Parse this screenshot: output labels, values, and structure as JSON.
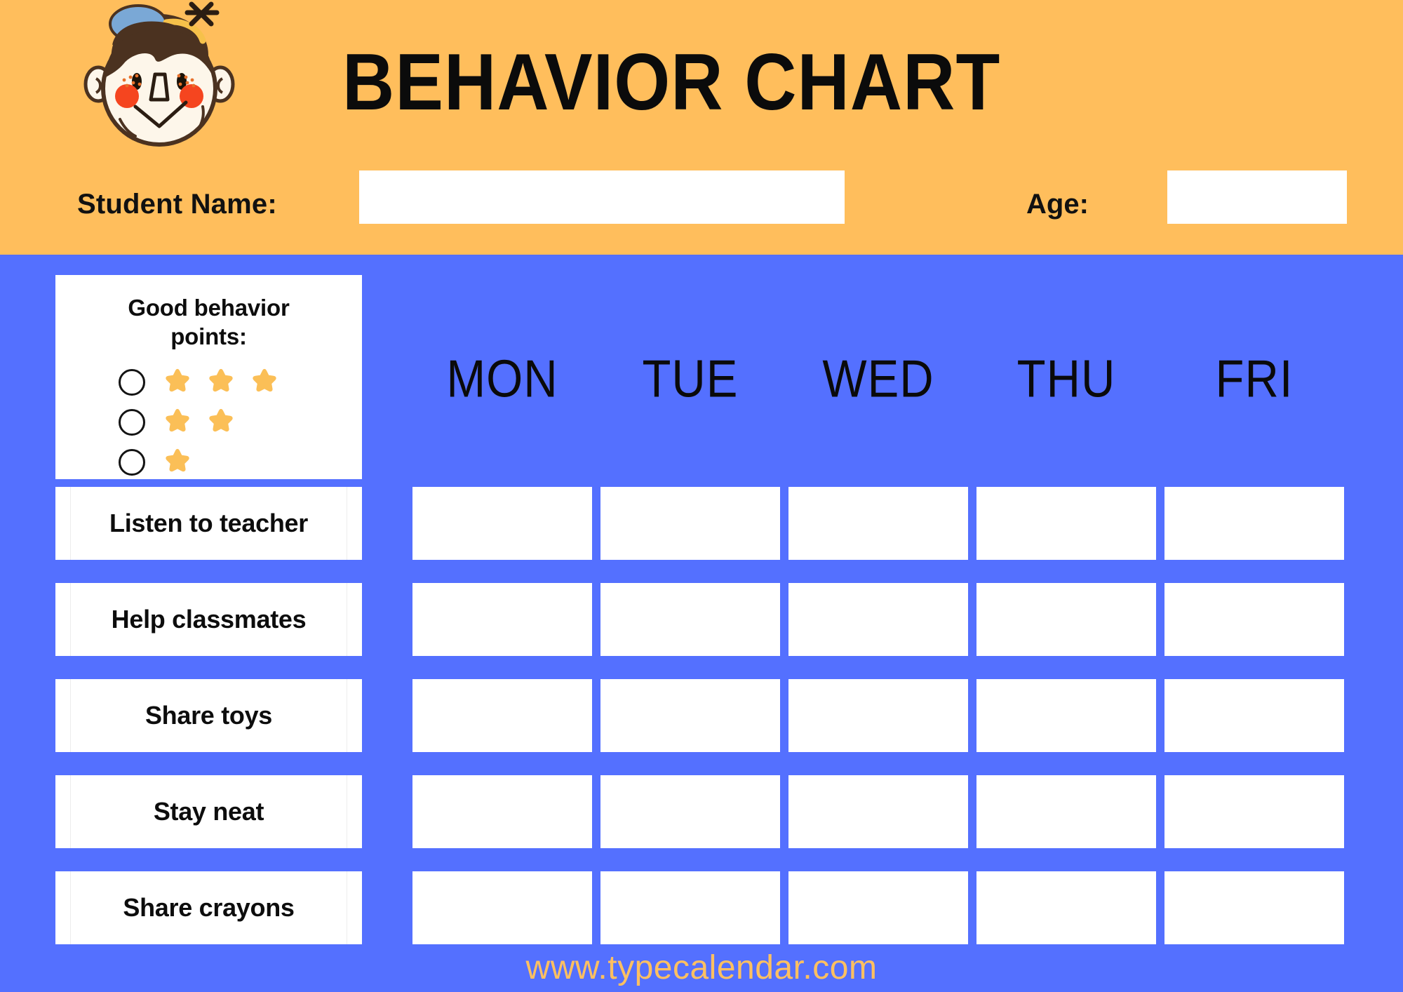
{
  "theme": {
    "header_bg": "#ffbe5c",
    "body_bg": "#5470ff",
    "cell_bg": "#ffffff",
    "star_color": "#fbbf57",
    "text_color": "#0d0d0d",
    "footer_color": "#ffc061"
  },
  "header": {
    "title": "BEHAVIOR CHART",
    "student_name_label": "Student Name:",
    "student_name_value": "",
    "student_name_placeholder": "",
    "age_label": "Age:",
    "age_value": "",
    "age_placeholder": "",
    "mascot_icon": "child-face-icon"
  },
  "legend": {
    "title_line1": "Good behavior",
    "title_line2": "points:",
    "rows": [
      {
        "checkbox": "circle-checkbox",
        "stars": 3
      },
      {
        "checkbox": "circle-checkbox",
        "stars": 2
      },
      {
        "checkbox": "circle-checkbox",
        "stars": 1
      }
    ]
  },
  "chart_data": {
    "type": "table",
    "title": "BEHAVIOR CHART",
    "columns": [
      "MON",
      "TUE",
      "WED",
      "THU",
      "FRI"
    ],
    "rows": [
      "Listen to teacher",
      "Help classmates",
      "Share toys",
      "Stay neat",
      "Share crayons"
    ],
    "values": [
      [
        "",
        "",
        "",
        "",
        ""
      ],
      [
        "",
        "",
        "",
        "",
        ""
      ],
      [
        "",
        "",
        "",
        "",
        ""
      ],
      [
        "",
        "",
        "",
        "",
        ""
      ],
      [
        "",
        "",
        "",
        "",
        ""
      ]
    ],
    "legend": [
      "3 stars",
      "2 stars",
      "1 star"
    ],
    "xlabel": "",
    "ylabel": ""
  },
  "footer": {
    "url": "www.typecalendar.com"
  }
}
